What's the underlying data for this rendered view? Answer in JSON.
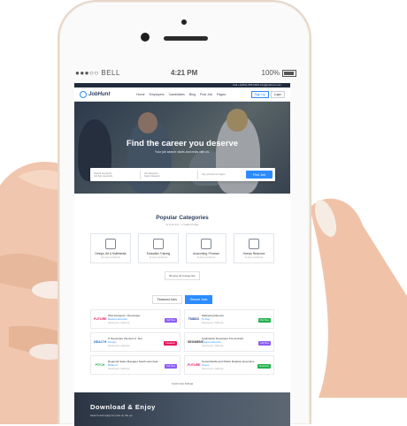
{
  "status": {
    "carrier": "●●●○○ BELL",
    "time": "4:21 PM",
    "battery": "100%"
  },
  "topbar": {
    "text": "Call +1(800) 555-0000   info@jobhunt.com"
  },
  "nav": {
    "brand": "JobHunt",
    "items": [
      "Home",
      "Employers",
      "Candidates",
      "Blog",
      "Post Job",
      "Pages"
    ],
    "signup": "Sign Up",
    "login": "Login"
  },
  "hero": {
    "title": "Find the career you deserve",
    "subtitle": "Your job search starts and ends with us.",
    "keyword_label": "Search keywords",
    "keyword_hint": "Job title, keywords",
    "category_label": "All categories",
    "category_hint": "Select category",
    "location_label": "City, province or region",
    "button": "Find Job"
  },
  "categories": {
    "title": "Popular Categories",
    "subtitle": "37 jobs live – 0 added today",
    "items": [
      {
        "label": "Design, Art & Multimedia",
        "count": "(22 open positions)"
      },
      {
        "label": "Education Training",
        "count": "(6 open positions)"
      },
      {
        "label": "Accounting / Finance",
        "count": "(3 open positions)"
      },
      {
        "label": "Human Resource",
        "count": "(3 open positions)"
      }
    ],
    "browse": "Browse All Categories"
  },
  "jobs": {
    "tabs": [
      "Featured Jobs",
      "Recent Jobs"
    ],
    "list": [
      {
        "logo": "FUTURE",
        "title": "Web Designer / Developer",
        "company": "Massimo Artemisis",
        "loc": "Sacramento, California",
        "type": "Full Time",
        "color": "#8b5cf6"
      },
      {
        "logo": "TNDSC",
        "title": "Marketing Director",
        "company": "Tix Dog",
        "loc": "Sacramento, California",
        "type": "Part Time",
        "color": "#22b14c"
      },
      {
        "logo": "HEALTH",
        "title": "C Developer (Senior) C .Net",
        "company": "Koncept",
        "loc": "Sacramento, California",
        "type": "Freelance",
        "color": "#e5195f"
      },
      {
        "logo": "SEGMENT",
        "title": "Application Developer For Android",
        "company": "Massimo Artemisis",
        "loc": "Sacramento, California",
        "type": "Full Time",
        "color": "#8b5cf6"
      },
      {
        "logo": "PITCH",
        "title": "Regional Sales Manager South east Asia",
        "company": "Mobile Ui",
        "loc": "Sacramento, California",
        "type": "Full Time",
        "color": "#8b5cf6"
      },
      {
        "logo": "FUTURE",
        "title": "Social Media and Public Relation Executive",
        "company": "Ucrane",
        "loc": "Sacramento, California",
        "type": "Temporary",
        "color": "#22b14c"
      }
    ],
    "load_more": "Load more listings"
  },
  "footer": {
    "title": "Download & Enjoy",
    "subtitle": "Search and apply for jobs on the go."
  }
}
